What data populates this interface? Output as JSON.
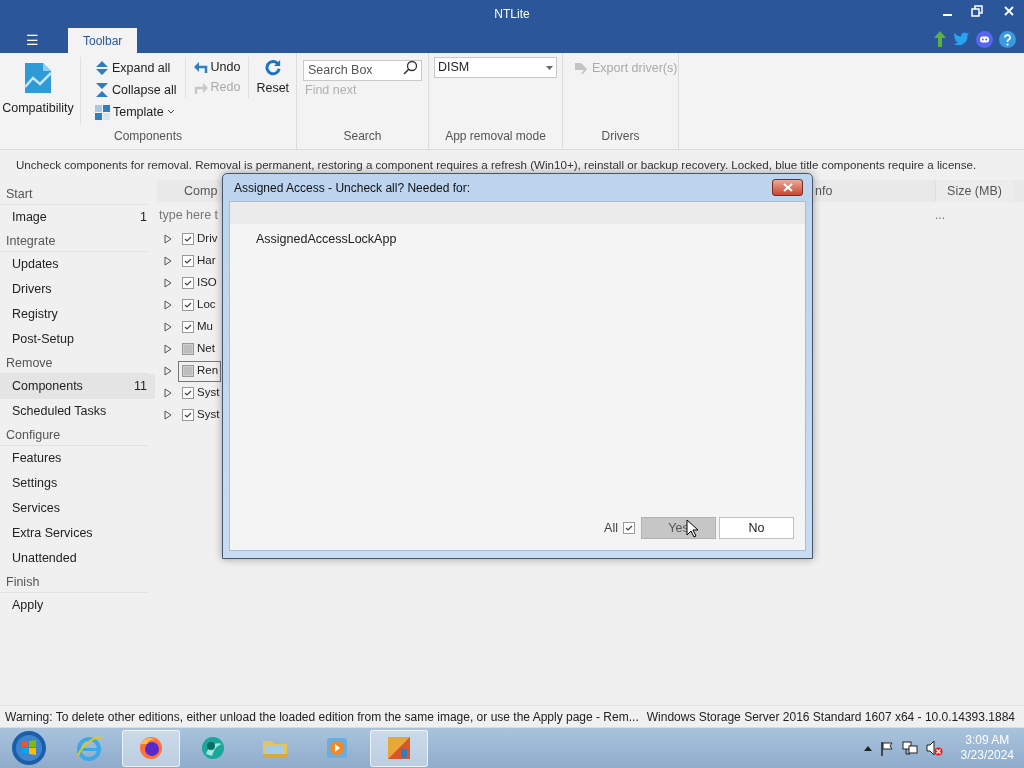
{
  "window": {
    "title": "NTLite"
  },
  "menu_button": "☰",
  "tabs": [
    {
      "label": "Toolbar",
      "selected": true
    }
  ],
  "ribbon": {
    "components": {
      "label": "Components",
      "compatibility": "Compatibility",
      "expand_all": "Expand all",
      "collapse_all": "Collapse all",
      "template": "Template",
      "undo": {
        "label": "Undo",
        "disabled": false
      },
      "redo": {
        "label": "Redo",
        "disabled": true
      },
      "reset": "Reset"
    },
    "search": {
      "label": "Search",
      "placeholder": "Search Box",
      "find_next": {
        "label": "Find next",
        "disabled": true
      }
    },
    "app_removal_mode": {
      "label": "App removal mode",
      "value": "DISM"
    },
    "drivers": {
      "label": "Drivers",
      "export": {
        "label": "Export driver(s)",
        "disabled": true
      }
    }
  },
  "hint": "Uncheck components for removal. Removal is permanent, restoring a component requires a refresh (Win10+), reinstall or backup recovery. Locked, blue title components require a license.",
  "sidebar": [
    {
      "heading": "Start",
      "items": [
        {
          "label": "Image",
          "count": "1",
          "selected": false
        }
      ]
    },
    {
      "heading": "Integrate",
      "items": [
        {
          "label": "Updates",
          "selected": false
        },
        {
          "label": "Drivers",
          "selected": false
        },
        {
          "label": "Registry",
          "selected": false
        },
        {
          "label": "Post-Setup",
          "selected": false
        }
      ]
    },
    {
      "heading": "Remove",
      "items": [
        {
          "label": "Components",
          "count": "11",
          "selected": true
        },
        {
          "label": "Scheduled Tasks",
          "selected": false
        }
      ]
    },
    {
      "heading": "Configure",
      "items": [
        {
          "label": "Features",
          "selected": false
        },
        {
          "label": "Settings",
          "selected": false
        },
        {
          "label": "Services",
          "selected": false
        },
        {
          "label": "Extra Services",
          "selected": false
        },
        {
          "label": "Unattended",
          "selected": false
        }
      ]
    },
    {
      "heading": "Finish",
      "items": [
        {
          "label": "Apply",
          "selected": false
        }
      ]
    }
  ],
  "table": {
    "columns": [
      "Comp",
      "nfo",
      "Size (MB)"
    ],
    "filter_placeholder": "type here t",
    "filter_size_cell": "...",
    "rows": [
      {
        "label": "Driv",
        "checked": true,
        "indeterminate": false,
        "focused": false
      },
      {
        "label": "Har",
        "checked": true,
        "indeterminate": false,
        "focused": false
      },
      {
        "label": "ISO",
        "checked": true,
        "indeterminate": false,
        "focused": false
      },
      {
        "label": "Loc",
        "checked": true,
        "indeterminate": false,
        "focused": false
      },
      {
        "label": "Mu",
        "checked": true,
        "indeterminate": false,
        "focused": false
      },
      {
        "label": "Net",
        "checked": false,
        "indeterminate": true,
        "focused": false
      },
      {
        "label": "Ren",
        "checked": false,
        "indeterminate": true,
        "focused": true
      },
      {
        "label": "Syst",
        "checked": true,
        "indeterminate": false,
        "focused": false
      },
      {
        "label": "Syst",
        "checked": true,
        "indeterminate": false,
        "focused": false
      }
    ]
  },
  "dialog": {
    "title": "Assigned Access - Uncheck all? Needed for:",
    "items": [
      "AssignedAccessLockApp"
    ],
    "all_label": "All",
    "all_checked": true,
    "buttons": [
      {
        "label": "Yes",
        "selected": true
      },
      {
        "label": "No",
        "selected": false
      }
    ]
  },
  "status_bar": {
    "left": "Warning: To delete other editions, either unload the loaded edition from the same image, or use the Apply page - Rem...",
    "right": "Windows Storage Server 2016 Standard 1607 x64 - 10.0.14393.1884"
  },
  "taskbar": {
    "apps": [
      {
        "kind": "ie",
        "active": false
      },
      {
        "kind": "firefox",
        "active": true
      },
      {
        "kind": "teal",
        "active": false
      },
      {
        "kind": "folder",
        "active": false
      },
      {
        "kind": "media",
        "active": false
      },
      {
        "kind": "ntlite",
        "active": true
      }
    ],
    "time": "3:09 AM",
    "date": "3/23/2024"
  }
}
